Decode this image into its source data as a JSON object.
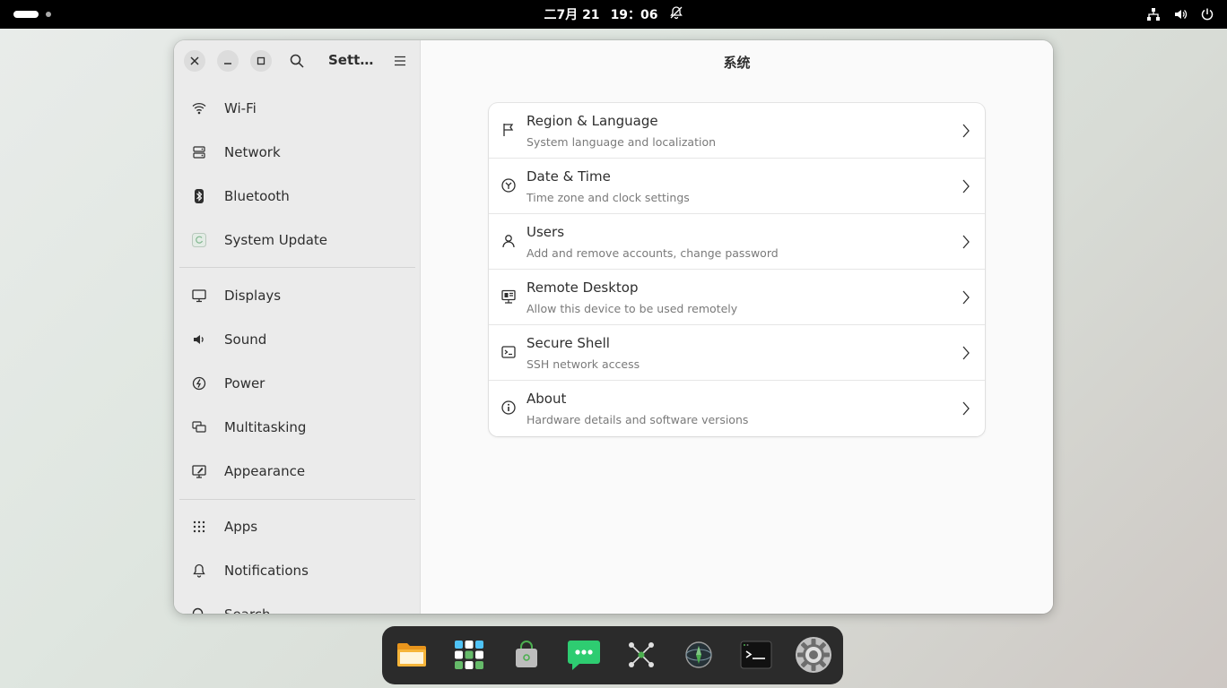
{
  "topbar": {
    "date": "二7月 21",
    "time": "19：06",
    "icons": [
      "notifications-off-icon",
      "network-icon",
      "volume-icon",
      "power-icon"
    ]
  },
  "window": {
    "sidebar_title": "Sett…",
    "content_title": "系统"
  },
  "sidebar": {
    "items": [
      {
        "label": "Wi-Fi",
        "icon": "wifi-icon"
      },
      {
        "label": "Network",
        "icon": "network-icon"
      },
      {
        "label": "Bluetooth",
        "icon": "bluetooth-icon"
      },
      {
        "label": "System Update",
        "icon": "system-update-icon"
      },
      {
        "label": "Displays",
        "icon": "display-icon"
      },
      {
        "label": "Sound",
        "icon": "speaker-icon"
      },
      {
        "label": "Power",
        "icon": "power-icon"
      },
      {
        "label": "Multitasking",
        "icon": "multitasking-icon"
      },
      {
        "label": "Appearance",
        "icon": "appearance-icon"
      },
      {
        "label": "Apps",
        "icon": "apps-grid-icon"
      },
      {
        "label": "Notifications",
        "icon": "bell-icon"
      },
      {
        "label": "Search",
        "icon": "search-icon"
      }
    ]
  },
  "system": {
    "rows": [
      {
        "title": "Region & Language",
        "subtitle": "System language and localization",
        "icon": "flag-icon"
      },
      {
        "title": "Date & Time",
        "subtitle": "Time zone and clock settings",
        "icon": "clock-icon"
      },
      {
        "title": "Users",
        "subtitle": "Add and remove accounts, change password",
        "icon": "user-icon"
      },
      {
        "title": "Remote Desktop",
        "subtitle": "Allow this device to be used remotely",
        "icon": "remote-desktop-icon"
      },
      {
        "title": "Secure Shell",
        "subtitle": "SSH network access",
        "icon": "terminal-icon"
      },
      {
        "title": "About",
        "subtitle": "Hardware details and software versions",
        "icon": "info-icon"
      }
    ]
  },
  "dock": {
    "apps": [
      "files-app-icon",
      "app-grid-icon",
      "software-store-icon",
      "chat-app-icon",
      "network-graph-app-icon",
      "browser-compass-icon",
      "terminal-app-icon",
      "settings-gear-icon"
    ]
  },
  "colors": {
    "topbar_bg": "#000000",
    "sidebar_bg": "#ebebeb",
    "content_bg": "#fafafa",
    "dock_bg": "#2b2b2b",
    "chat_green": "#2ecc71",
    "files_orange": "#f6a623"
  }
}
